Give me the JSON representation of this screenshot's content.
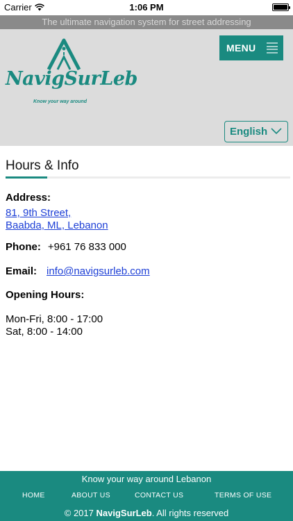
{
  "status_bar": {
    "carrier": "Carrier",
    "time": "1:06 PM",
    "wifi_icon": "wifi-icon",
    "battery_level": 1.0
  },
  "tagline": "The ultimate navigation system for street addressing",
  "header": {
    "logo_name": "NavigSurLeb",
    "logo_slogan": "Know your way around",
    "menu_label": "MENU",
    "language": "English"
  },
  "info": {
    "title": "Hours & Info",
    "address_label": "Address:",
    "address_line1": "81, 9th Street,",
    "address_line2": "Baabda, ML, Lebanon",
    "phone_label": "Phone:",
    "phone_value": "+961 76 833 000",
    "email_label": "Email:",
    "email_value": "info@navigsurleb.com",
    "hours_label": "Opening Hours:",
    "hours": [
      "Mon-Fri, 8:00 - 17:00",
      "Sat, 8:00 - 14:00"
    ]
  },
  "footer": {
    "tagline": "Know your way around Lebanon",
    "nav": [
      "HOME",
      "ABOUT US",
      "CONTACT US",
      "TERMS OF USE"
    ],
    "copyright_prefix": "© 2017 ",
    "copyright_brand": "NavigSurLeb",
    "copyright_suffix": ". All rights reserved"
  },
  "colors": {
    "accent": "#1a8a80",
    "header_bg": "#dcdcdc",
    "tagline_bg": "#8a8a8a",
    "link": "#1d3fd6"
  }
}
